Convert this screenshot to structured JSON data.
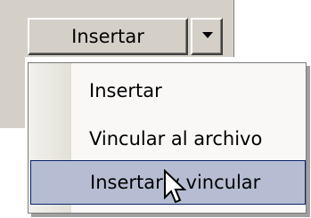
{
  "split_button": {
    "label": "Insertar"
  },
  "menu": {
    "items": [
      {
        "label": "Insertar",
        "selected": false
      },
      {
        "label": "Vincular al archivo",
        "selected": false
      },
      {
        "label": "Insertar y vincular",
        "selected": true
      }
    ]
  },
  "colors": {
    "face": "#d4d0c8",
    "highlight": "#b6bdd2",
    "highlight_border": "#0a246a"
  },
  "icons": {
    "dropdown_arrow": "chevron-down-icon",
    "cursor": "mouse-pointer-icon"
  }
}
